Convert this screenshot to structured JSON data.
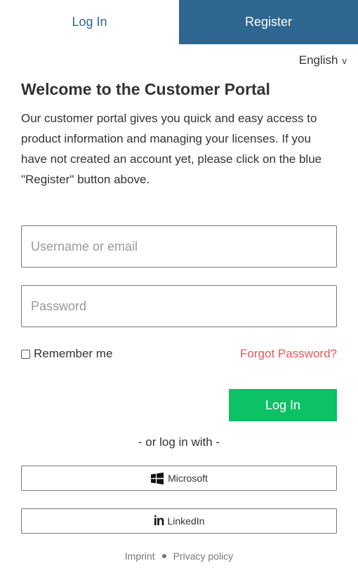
{
  "tabs": {
    "login": "Log In",
    "register": "Register"
  },
  "language": {
    "selected": "English",
    "chevron": "v"
  },
  "welcome": {
    "title": "Welcome to the Customer Portal",
    "text": "Our customer portal gives you quick and easy access to product information and managing your licenses. If you have not created an account yet, please click on the blue \"Register\" button above."
  },
  "form": {
    "username_placeholder": "Username or email",
    "password_placeholder": "Password",
    "remember_label": "Remember me",
    "forgot_label": "Forgot Password?",
    "submit_label": "Log In"
  },
  "social": {
    "divider": "- or log in with -",
    "microsoft_label": "Microsoft",
    "linkedin_label": "LinkedIn",
    "linkedin_icon_text": "in"
  },
  "footer": {
    "imprint": "Imprint",
    "privacy": "Privacy policy"
  },
  "colors": {
    "brand_blue": "#2f6690",
    "login_green": "#0dc167",
    "forgot_red": "#e8585a"
  },
  "icons": [
    "windows-logo-icon",
    "linkedin-logo-icon",
    "chevron-down-icon"
  ]
}
